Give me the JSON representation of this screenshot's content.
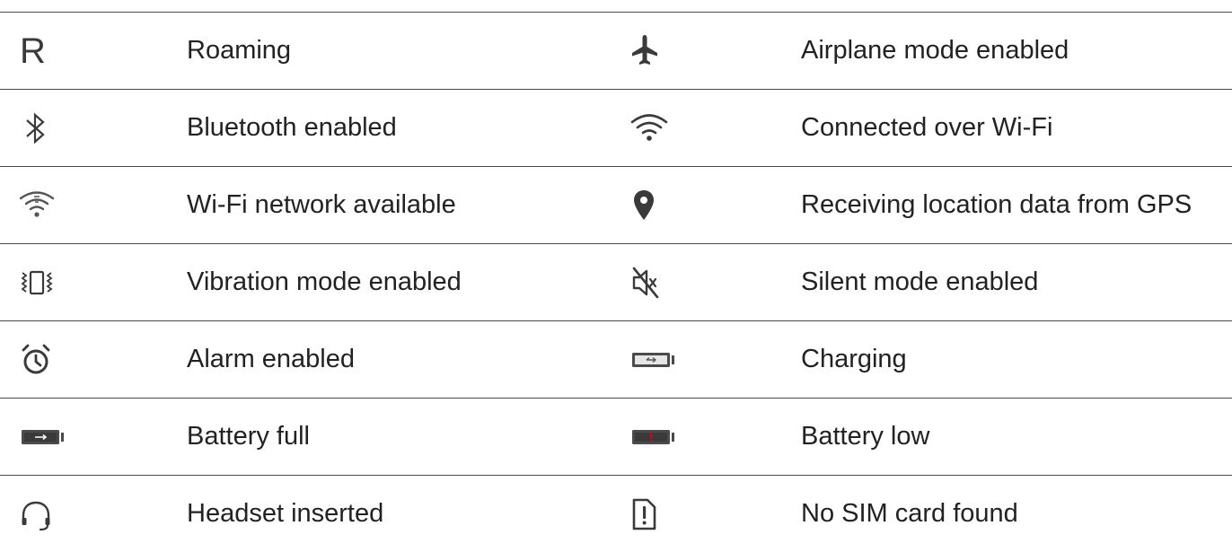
{
  "rows": [
    {
      "left": {
        "icon": "roaming-icon",
        "glyph": "R",
        "label": "Roaming"
      },
      "right": {
        "icon": "airplane-icon",
        "label": "Airplane mode enabled"
      }
    },
    {
      "left": {
        "icon": "bluetooth-icon",
        "label": "Bluetooth enabled"
      },
      "right": {
        "icon": "wifi-connected-icon",
        "label": "Connected over Wi-Fi"
      }
    },
    {
      "left": {
        "icon": "wifi-available-icon",
        "label": "Wi-Fi network available"
      },
      "right": {
        "icon": "location-pin-icon",
        "label": "Receiving location data from GPS"
      }
    },
    {
      "left": {
        "icon": "vibration-icon",
        "label": "Vibration mode enabled"
      },
      "right": {
        "icon": "silent-icon",
        "label": "Silent mode enabled"
      }
    },
    {
      "left": {
        "icon": "alarm-icon",
        "label": "Alarm enabled"
      },
      "right": {
        "icon": "battery-charging-icon",
        "label": "Charging"
      }
    },
    {
      "left": {
        "icon": "battery-full-icon",
        "label": "Battery full"
      },
      "right": {
        "icon": "battery-low-icon",
        "label": "Battery low"
      }
    },
    {
      "left": {
        "icon": "headset-icon",
        "label": "Headset inserted"
      },
      "right": {
        "icon": "no-sim-icon",
        "label": "No SIM card found"
      }
    }
  ],
  "colors": {
    "icon": "#4a4a4a",
    "text": "#222222",
    "rule": "#4a4a4a",
    "battery_low_accent": "#d0021b"
  }
}
